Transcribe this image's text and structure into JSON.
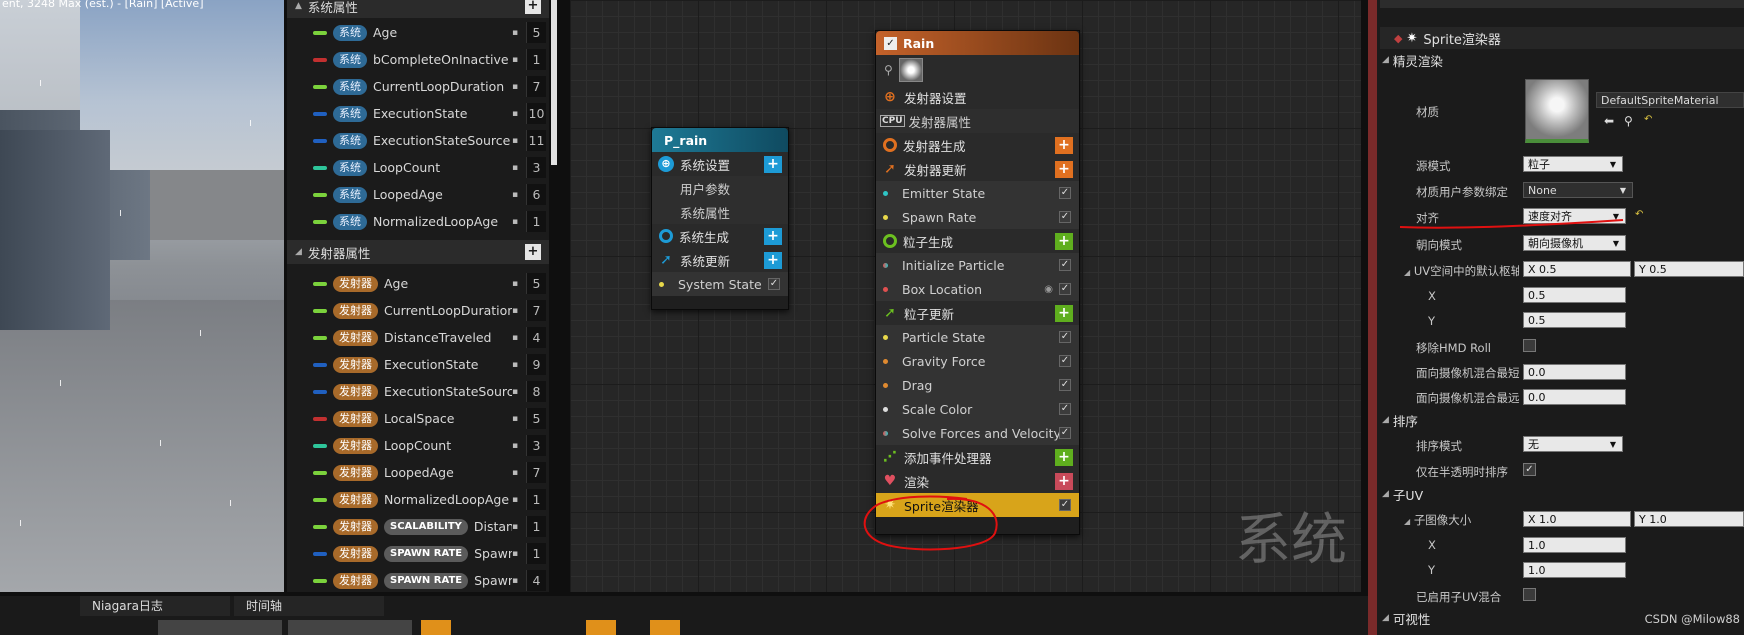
{
  "viewport": {
    "title": "ent, 3248 Max (est.) - [Rain] [Active]"
  },
  "params": {
    "system_section": "系统属性",
    "system_rows": [
      {
        "color": "#7bd23c",
        "tag": "系统",
        "name": "Age",
        "num": "5"
      },
      {
        "color": "#c23030",
        "tag": "系统",
        "name": "bCompleteOnInactive",
        "num": "1"
      },
      {
        "color": "#7bd23c",
        "tag": "系统",
        "name": "CurrentLoopDuration",
        "num": "7"
      },
      {
        "color": "#2060c0",
        "tag": "系统",
        "name": "ExecutionState",
        "num": "10"
      },
      {
        "color": "#2060c0",
        "tag": "系统",
        "name": "ExecutionStateSource",
        "num": "11"
      },
      {
        "color": "#2ec59a",
        "tag": "系统",
        "name": "LoopCount",
        "num": "3"
      },
      {
        "color": "#7bd23c",
        "tag": "系统",
        "name": "LoopedAge",
        "num": "6"
      },
      {
        "color": "#7bd23c",
        "tag": "系统",
        "name": "NormalizedLoopAge",
        "num": "1"
      }
    ],
    "emitter_section": "发射器属性",
    "emitter_rows": [
      {
        "color": "#7bd23c",
        "tag": "发射器",
        "tag2": "",
        "name": "Age",
        "num": "5"
      },
      {
        "color": "#7bd23c",
        "tag": "发射器",
        "tag2": "",
        "name": "CurrentLoopDuration",
        "num": "7"
      },
      {
        "color": "#7bd23c",
        "tag": "发射器",
        "tag2": "",
        "name": "DistanceTraveled",
        "num": "4"
      },
      {
        "color": "#2060c0",
        "tag": "发射器",
        "tag2": "",
        "name": "ExecutionState",
        "num": "9"
      },
      {
        "color": "#2060c0",
        "tag": "发射器",
        "tag2": "",
        "name": "ExecutionStateSource",
        "num": "8"
      },
      {
        "color": "#c23030",
        "tag": "发射器",
        "tag2": "",
        "name": "LocalSpace",
        "num": "5"
      },
      {
        "color": "#2ec59a",
        "tag": "发射器",
        "tag2": "",
        "name": "LoopCount",
        "num": "3"
      },
      {
        "color": "#7bd23c",
        "tag": "发射器",
        "tag2": "",
        "name": "LoopedAge",
        "num": "7"
      },
      {
        "color": "#7bd23c",
        "tag": "发射器",
        "tag2": "",
        "name": "NormalizedLoopAge",
        "num": "1"
      },
      {
        "color": "#7bd23c",
        "tag": "发射器",
        "tag2": "SCALABILITY",
        "name": "Distanc",
        "num": "1"
      },
      {
        "color": "#2060c0",
        "tag": "发射器",
        "tag2": "SPAWN RATE",
        "name": "Spawn",
        "num": "1"
      },
      {
        "color": "#7bd23c",
        "tag": "发射器",
        "tag2": "SPAWN RATE",
        "name": "Spawn",
        "num": "4"
      }
    ]
  },
  "graph": {
    "watermark": "系统",
    "system_node": {
      "title": "P_rain",
      "rows": [
        "系统设置",
        "用户参数",
        "系统属性",
        "系统生成",
        "系统更新",
        "System State"
      ]
    },
    "emitter_node": {
      "title": "Rain",
      "rows": [
        "发射器设置",
        "发射器属性",
        "发射器生成",
        "发射器更新",
        "Emitter State",
        "Spawn Rate",
        "粒子生成",
        "Initialize Particle",
        "Box Location",
        "粒子更新",
        "Particle State",
        "Gravity Force",
        "Drag",
        "Scale Color",
        "Solve Forces and Velocity",
        "添加事件处理器",
        "渲染",
        "Sprite渲染器"
      ],
      "cpu_label": "CPU"
    }
  },
  "details": {
    "header": "Sprite渲染器",
    "sec_sprite": "精灵渲染",
    "material_label": "材质",
    "material_value": "DefaultSpriteMaterial",
    "source_mode_label": "源模式",
    "source_mode_value": "粒子",
    "mat_user_label": "材质用户参数绑定",
    "mat_user_value": "None",
    "align_label": "对齐",
    "align_value": "速度对齐",
    "facing_label": "朝向模式",
    "facing_value": "朝向摄像机",
    "uv_label": "UV空间中的默认枢轴",
    "uv_x_value": "X  0.5",
    "uv_y_value": "Y  0.5",
    "x_label": "X",
    "x_value": "0.5",
    "y_label": "Y",
    "y_value": "0.5",
    "hmd_label": "移除HMD Roll",
    "face_near_label": "面向摄像机混合最短",
    "face_near_value": "0.0",
    "face_far_label": "面向摄像机混合最远",
    "face_far_value": "0.0",
    "sec_sort": "排序",
    "sort_mode_label": "排序模式",
    "sort_mode_value": "无",
    "sort_trans_label": "仅在半透明时排序",
    "sec_subuv": "子UV",
    "subimg_label": "子图像大小",
    "subimg_x": "X  1.0",
    "subimg_y": "Y  1.0",
    "sx_label": "X",
    "sx_value": "1.0",
    "sy_label": "Y",
    "sy_value": "1.0",
    "subuv_blend_label": "已启用子UV混合",
    "sec_vis": "可视性",
    "credit": "CSDN @Milow88"
  },
  "bottom": {
    "tab_log": "Niagara日志",
    "tab_timeline": "时间轴"
  }
}
